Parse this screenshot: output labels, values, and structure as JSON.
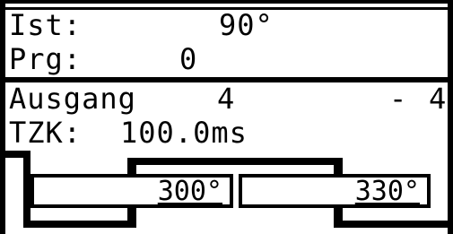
{
  "status": {
    "ist_label": "Ist:",
    "ist_value": "90°",
    "prg_label": "Prg:",
    "prg_value": "0"
  },
  "output": {
    "label": "Ausgang",
    "from": "4",
    "separator": "-",
    "to": "4"
  },
  "tzk": {
    "label": "TZK:",
    "value": "100.0ms"
  },
  "cam": {
    "on_angle": "300°",
    "off_angle": "330°"
  },
  "colors": {
    "foreground": "#000000",
    "background": "#ffffff"
  }
}
